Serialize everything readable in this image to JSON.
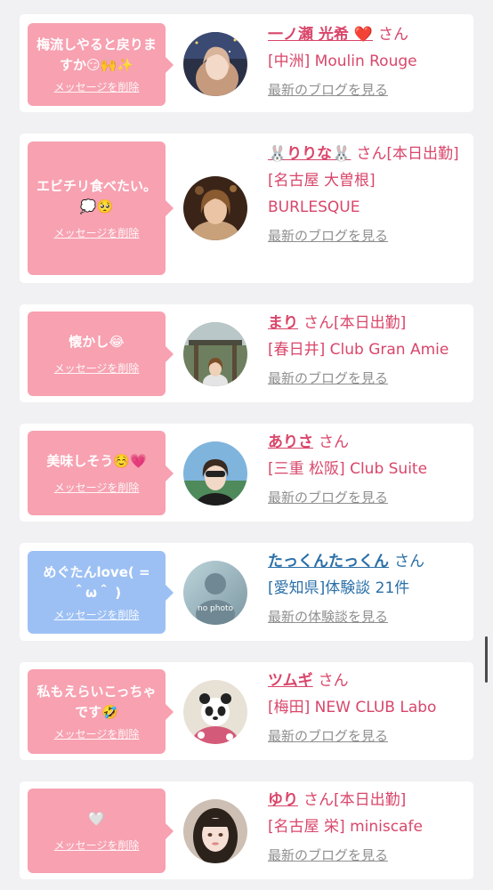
{
  "cards": [
    {
      "message": "梅流しやると戻りますか😏🙌✨",
      "delete_label": "メッセージを削除",
      "name": "一ノ瀬 光希 ❤️",
      "suffix": "さん",
      "shop": "[中洲] Moulin Rouge",
      "link": "最新のブログを見る",
      "bubble_color": "#f7a1b1"
    },
    {
      "message": "エビチリ食べたい。💭🥺",
      "delete_label": "メッセージを削除",
      "name": "🐰りりな🐰",
      "suffix": "さん[本日出勤]",
      "shop": "[名古屋 大曽根] BURLESQUE",
      "link": "最新のブログを見る",
      "bubble_color": "#f7a1b1"
    },
    {
      "message": "懐かし😂",
      "delete_label": "メッセージを削除",
      "name": "まり",
      "suffix": "さん[本日出勤]",
      "shop": "[春日井] Club Gran Amie",
      "link": "最新のブログを見る",
      "bubble_color": "#f7a1b1"
    },
    {
      "message": "美味しそう☺️💗",
      "delete_label": "メッセージを削除",
      "name": "ありさ",
      "suffix": "さん",
      "shop": "[三重 松阪] Club Suite",
      "link": "最新のブログを見る",
      "bubble_color": "#f7a1b1"
    },
    {
      "message": "めぐたんlove( = ＾ω＾ )",
      "delete_label": "メッセージを削除",
      "name": "たっくんたっくん",
      "suffix": "さん",
      "shop": "[愛知県]体験談 21件",
      "link": "最新の体験談を見る",
      "bubble_color": "#9cc0f4",
      "avatar_text": "no photo"
    },
    {
      "message": "私もえらいこっちゃです🤣",
      "delete_label": "メッセージを削除",
      "name": "ツムギ",
      "suffix": "さん",
      "shop": "[梅田] NEW CLUB Labo",
      "link": "最新のブログを見る",
      "bubble_color": "#f7a1b1"
    },
    {
      "message": "🤍",
      "delete_label": "メッセージを削除",
      "name": "ゆり",
      "suffix": "さん[本日出勤]",
      "shop": "[名古屋 栄] miniscafe",
      "link": "最新のブログを見る",
      "bubble_color": "#f7a1b1"
    }
  ]
}
